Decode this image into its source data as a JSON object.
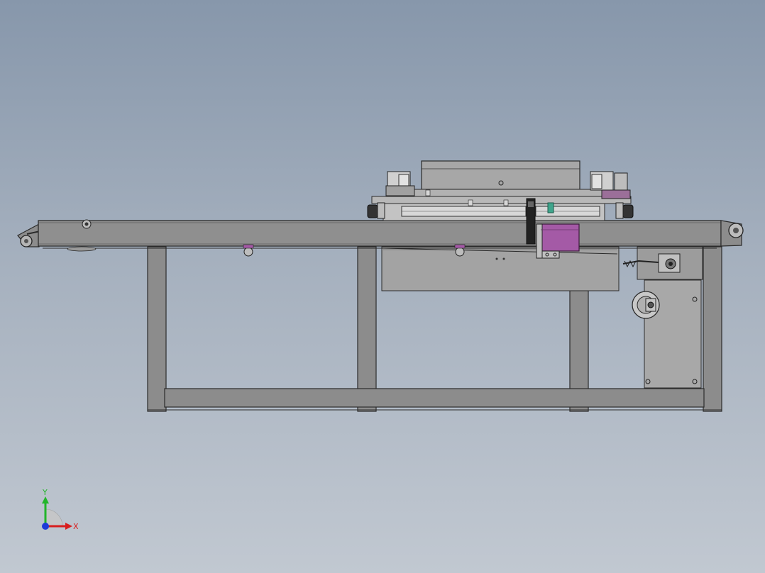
{
  "triad": {
    "y_label": "Y",
    "x_label": "X",
    "colors": {
      "x": "#d81e1e",
      "y": "#22b52a",
      "z": "#1f3bd8"
    }
  },
  "model": {
    "frame_fill": "#8c8c8c",
    "frame_stroke": "#2b2b2b",
    "motor_color": "#a45aa6",
    "light_fill": "#c3c3c3"
  }
}
